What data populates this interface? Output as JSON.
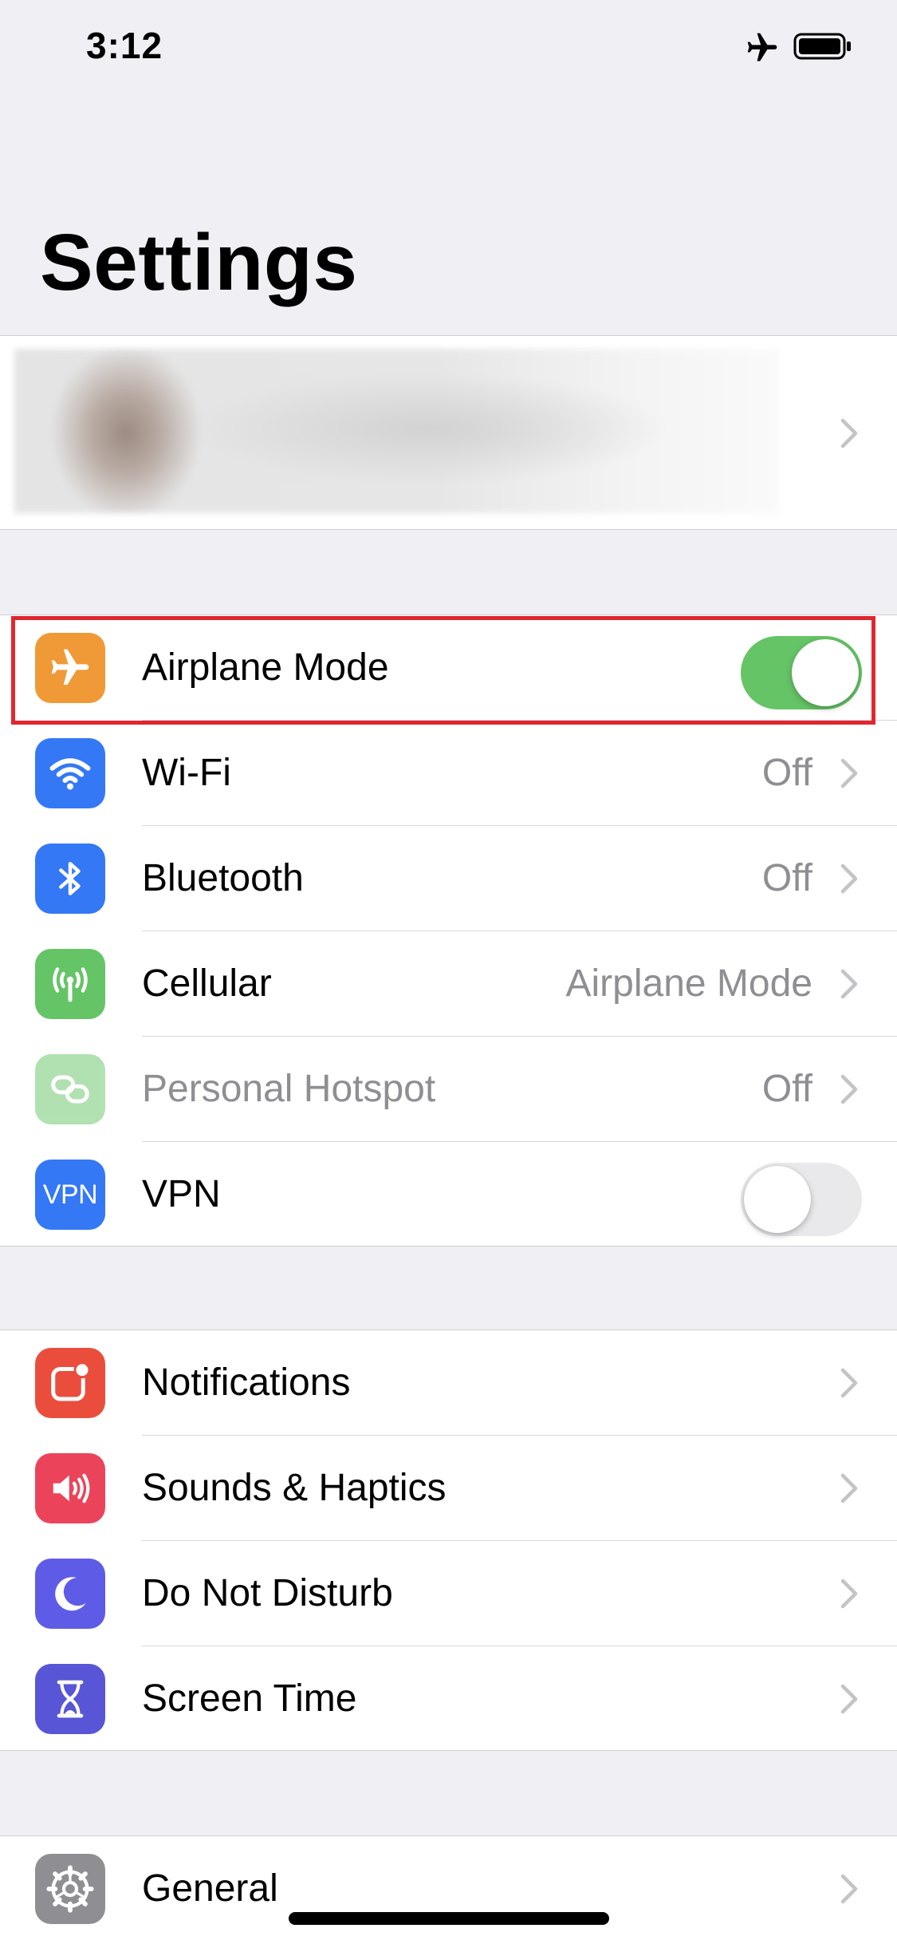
{
  "status_bar": {
    "time": "3:12",
    "icons": [
      "airplane-icon",
      "battery-icon"
    ]
  },
  "title": "Settings",
  "connectivity": [
    {
      "label": "Airplane Mode",
      "control": "toggle",
      "on": true,
      "icon": "airplane-icon",
      "icon_color": "#f09a37"
    },
    {
      "label": "Wi-Fi",
      "value": "Off",
      "icon": "wifi-icon",
      "icon_color": "#3478f6"
    },
    {
      "label": "Bluetooth",
      "value": "Off",
      "icon": "bluetooth-icon",
      "icon_color": "#3478f6"
    },
    {
      "label": "Cellular",
      "value": "Airplane Mode",
      "icon": "cellular-antenna-icon",
      "icon_color": "#65c466"
    },
    {
      "label": "Personal Hotspot",
      "value": "Off",
      "disabled": true,
      "icon": "hotspot-link-icon",
      "icon_color": "#65c466"
    },
    {
      "label": "VPN",
      "control": "toggle",
      "on": false,
      "icon": "vpn-icon",
      "icon_text": "VPN",
      "icon_color": "#3478f6"
    }
  ],
  "notifications_group": [
    {
      "label": "Notifications",
      "icon": "notifications-icon",
      "icon_color": "#eb4d3d"
    },
    {
      "label": "Sounds & Haptics",
      "icon": "speaker-icon",
      "icon_color": "#eb445a"
    },
    {
      "label": "Do Not Disturb",
      "icon": "moon-icon",
      "icon_color": "#5e5ce6"
    },
    {
      "label": "Screen Time",
      "icon": "hourglass-icon",
      "icon_color": "#5856d6"
    }
  ],
  "general_group": [
    {
      "label": "General",
      "icon": "gear-icon",
      "icon_color": "#8e8e93"
    }
  ],
  "colors": {
    "background": "#efeff4",
    "toggle_on": "#65c466",
    "highlight": "#e0262f"
  }
}
